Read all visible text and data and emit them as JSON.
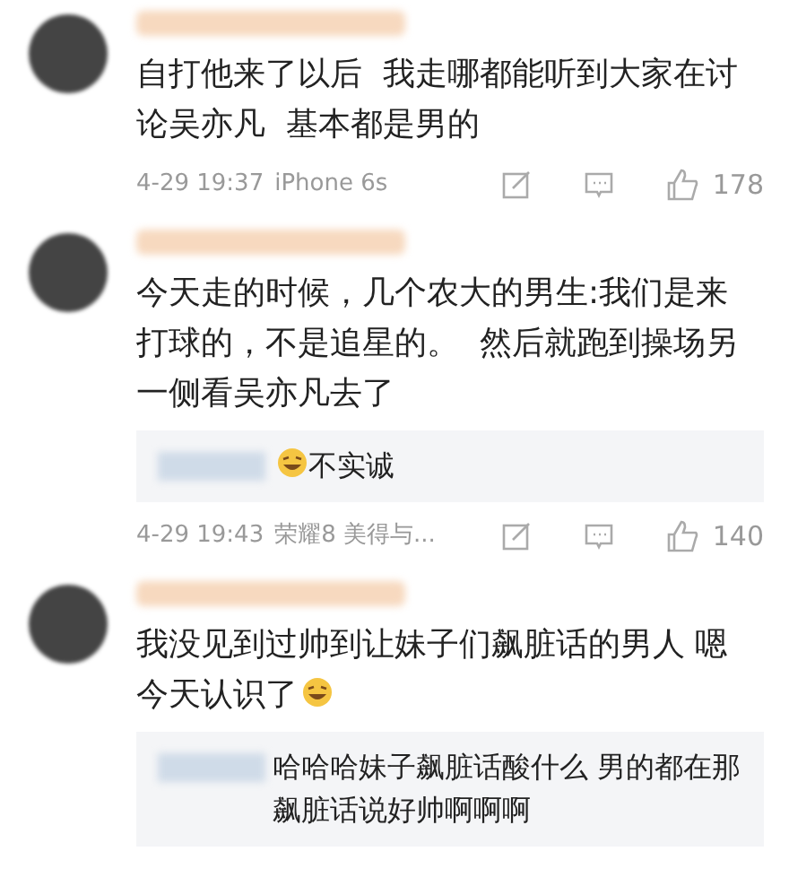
{
  "comments": [
    {
      "text": "自打他来了以后  我走哪都能听到大家在讨论吴亦凡  基本都是男的",
      "emoji": false,
      "time": "4-29 19:37",
      "device": "iPhone 6s",
      "likes": "178"
    },
    {
      "text": "今天走的时候，几个农大的男生:我们是来打球的，不是追星的。  然后就跑到操场另一侧看吴亦凡去了",
      "emoji": false,
      "reply": {
        "text": "不实诚",
        "emoji": true
      },
      "time": "4-29 19:43",
      "device": "荣耀8 美得与...",
      "likes": "140"
    },
    {
      "text": "我没见到过帅到让妹子们飙脏话的男人 嗯今天认识了",
      "emoji": true,
      "reply": {
        "text": "哈哈哈妹子飙脏话酸什么 男的都在那飙脏话说好帅啊啊啊",
        "emoji": false
      }
    }
  ]
}
